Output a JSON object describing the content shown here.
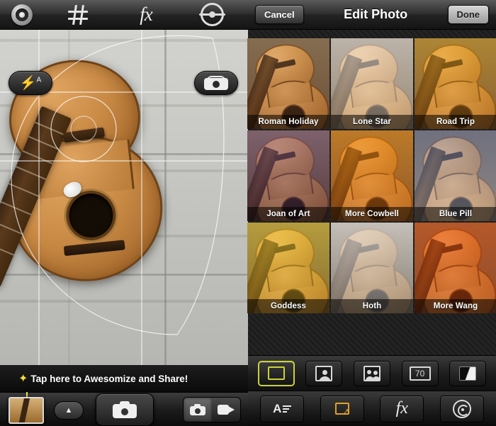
{
  "camera": {
    "toolbar": {
      "gear_icon": "gear-icon",
      "grid_icon": "grid-icon",
      "fx_label": "fx",
      "eye_icon": "eye-icon"
    },
    "flash": {
      "label": "A",
      "icon": "flash-bolt-icon"
    },
    "flip_camera": {
      "icon": "camera-flip-icon"
    },
    "awesomize_banner": {
      "sparkle": "✦",
      "text": "Tap here to Awesomize and Share!"
    },
    "bottom": {
      "thumbnail": "last-photo-thumbnail",
      "chevron": "▲",
      "shutter": "shutter-button",
      "mode_photo": "photo-mode",
      "mode_video": "video-mode"
    }
  },
  "editor": {
    "cancel_label": "Cancel",
    "title": "Edit Photo",
    "done_label": "Done",
    "filters": [
      {
        "name": "Roman Holiday",
        "wash": "linear-gradient(180deg, rgba(255,210,150,0.18), rgba(120,60,30,0.30))"
      },
      {
        "name": "Lone Star",
        "wash": "linear-gradient(180deg, rgba(255,255,255,0.55), rgba(210,195,175,0.45))"
      },
      {
        "name": "Road Trip",
        "wash": "linear-gradient(180deg, rgba(255,190,40,0.45), rgba(190,110,20,0.35))"
      },
      {
        "name": "Joan of Art",
        "wash": "linear-gradient(180deg, rgba(150,110,160,0.45), rgba(60,30,60,0.45))"
      },
      {
        "name": "More Cowbell",
        "wash": "linear-gradient(180deg, rgba(255,150,20,0.55), rgba(200,90,10,0.40))"
      },
      {
        "name": "Blue Pill",
        "wash": "linear-gradient(180deg, rgba(120,150,220,0.40), rgba(210,220,245,0.35))"
      },
      {
        "name": "Goddess",
        "wash": "linear-gradient(180deg, rgba(255,225,60,0.50), rgba(190,150,20,0.35))"
      },
      {
        "name": "Hoth",
        "wash": "linear-gradient(180deg, rgba(235,235,235,0.70), rgba(160,160,160,0.55))"
      },
      {
        "name": "More Wang",
        "wash": "linear-gradient(180deg, rgba(255,90,20,0.50), rgba(190,60,10,0.40))"
      }
    ],
    "tools_row1": [
      {
        "name": "frame-square-tool",
        "icon": "square-frame-icon",
        "active": true
      },
      {
        "name": "portrait-one-tool",
        "icon": "portrait-icon",
        "active": false
      },
      {
        "name": "portrait-two-tool",
        "icon": "two-portraits-icon",
        "active": false
      },
      {
        "name": "seventy-tool",
        "icon": "number-box-icon",
        "label": "70",
        "active": false
      },
      {
        "name": "gradient-tool",
        "icon": "gradient-icon",
        "active": false
      }
    ],
    "tools_row2": [
      {
        "name": "text-tool",
        "icon": "text-align-icon",
        "label": "A"
      },
      {
        "name": "crop-tool",
        "icon": "crop-icon"
      },
      {
        "name": "effects-tool",
        "icon": "fx-icon",
        "label": "fx"
      },
      {
        "name": "lens-tool",
        "icon": "swirl-lens-icon"
      }
    ]
  }
}
